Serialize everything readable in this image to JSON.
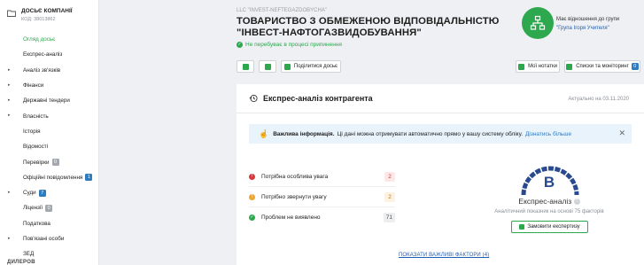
{
  "sidebar": {
    "title": "ДОСЬЄ КОМПАНІЇ",
    "code": "КОД: 38013862",
    "items": [
      {
        "label": "Огляд досьє",
        "active": true,
        "arrow": false
      },
      {
        "label": "Експрес-аналіз",
        "active": false,
        "arrow": false
      },
      {
        "label": "Аналіз зв'язків",
        "active": false,
        "arrow": true
      },
      {
        "label": "Фінанси",
        "active": false,
        "arrow": true
      },
      {
        "label": "Державні тендери",
        "active": false,
        "arrow": true
      },
      {
        "label": "Власність",
        "active": false,
        "arrow": true
      },
      {
        "label": "Історія",
        "active": false,
        "arrow": false
      },
      {
        "label": "Відомості",
        "active": false,
        "arrow": false
      },
      {
        "label": "Перевірки",
        "active": false,
        "arrow": false,
        "badge": "0",
        "badge_color": "gray"
      },
      {
        "label": "Офіційні повідомлення",
        "active": false,
        "arrow": false,
        "badge": "1",
        "badge_color": "blue"
      },
      {
        "label": "Суди",
        "active": false,
        "arrow": true,
        "badge": "7",
        "badge_color": "blue"
      },
      {
        "label": "Ліцензії",
        "active": false,
        "arrow": false,
        "badge": "0",
        "badge_color": "gray"
      },
      {
        "label": "Податкова",
        "active": false,
        "arrow": false
      },
      {
        "label": "Пов'язані особи",
        "active": false,
        "arrow": true
      },
      {
        "label": "ЗЕД",
        "active": false,
        "arrow": false
      }
    ],
    "footer": "ДИЛЕРОВ"
  },
  "header": {
    "latin_name": "LLC \"INVEST-NEFTEGAZDOBYCHA\"",
    "company_name": "ТОВАРИСТВО З ОБМЕЖЕНОЮ ВІДПОВІДАЛЬНІСТЮ \"ІНВЕСТ-НАФТОГАЗВИДОБУВАННЯ\"",
    "status": "Не перебуває в процесі припинення",
    "group_label": "Має відношення до групи",
    "group_link": "\"Група Ігоря Учителя\""
  },
  "toolbar": {
    "share_label": "Поділитися досьє",
    "notes_label": "Мої нотатки",
    "lists_label": "Списки та моніторинг",
    "lists_badge": "0"
  },
  "express": {
    "title": "Експрес-аналіз контрагента",
    "updated": "Актуально на 03.11.2020",
    "info_bold": "Важлива інформація.",
    "info_text": "Ці дані можна отримувати автоматично прямо у вашу систему обліку.",
    "info_link": "Дізнатись більше",
    "rows": [
      {
        "label": "Потрібна особлива увага",
        "count": "2",
        "color": "#d9363e",
        "bg": "#fde8e8",
        "icon": "!"
      },
      {
        "label": "Потрібно звернути увагу",
        "count": "2",
        "color": "#f0a530",
        "bg": "#fdf1e1",
        "icon": "!"
      },
      {
        "label": "Проблем не виявлено",
        "count": "71",
        "color": "#2da84e",
        "bg": "#eceef0",
        "icon": "✓"
      }
    ],
    "grade": "B",
    "score_title": "Експрес-аналіз",
    "score_sub": "Аналітичний показник на основі 75 факторів",
    "order_label": "Замовити експертизу",
    "show_factors": "ПОКАЗАТИ ВАЖЛИВІ ФАКТОРИ (4)"
  },
  "colors": {
    "accent": "#2da84e",
    "link": "#1f5fb3",
    "danger": "#d9363e",
    "warning": "#f0a530",
    "gauge": "#2a4a8f"
  }
}
